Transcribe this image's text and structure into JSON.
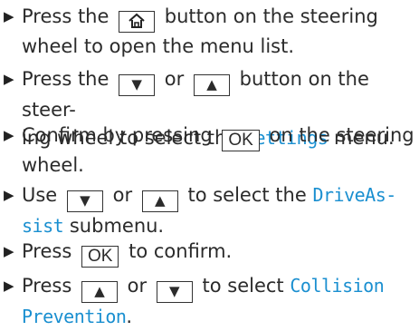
{
  "bullet": "▶",
  "steps": [
    {
      "a": "Press the",
      "key": "home-icon",
      "b": "button on the steering",
      "c": "wheel to open the menu list."
    },
    {
      "a": "Press the",
      "key1": "▼",
      "b": "or",
      "key2": "▲",
      "c": "button on the steer-",
      "d": "ing wheel to select the",
      "menu": "Settings",
      "e": "menu."
    },
    {
      "a": "Confirm by pressing",
      "key": "OK",
      "b": "on the steering",
      "c": "wheel."
    },
    {
      "a": "Use",
      "key1": "▼",
      "b": "or",
      "key2": "▲",
      "c": "to select the",
      "menu1": "DriveAs-",
      "menu2": "sist",
      "d": "submenu."
    },
    {
      "a": "Press",
      "key": "OK",
      "b": "to confirm."
    },
    {
      "a": "Press",
      "key1": "▲",
      "b": "or",
      "key2": "▼",
      "c": "to select",
      "menu1": "Collision",
      "menu2": "Prevention",
      "d": "."
    }
  ],
  "colors": {
    "text": "#2b2b2b",
    "menu": "#1a8fd0",
    "border": "#333333"
  }
}
